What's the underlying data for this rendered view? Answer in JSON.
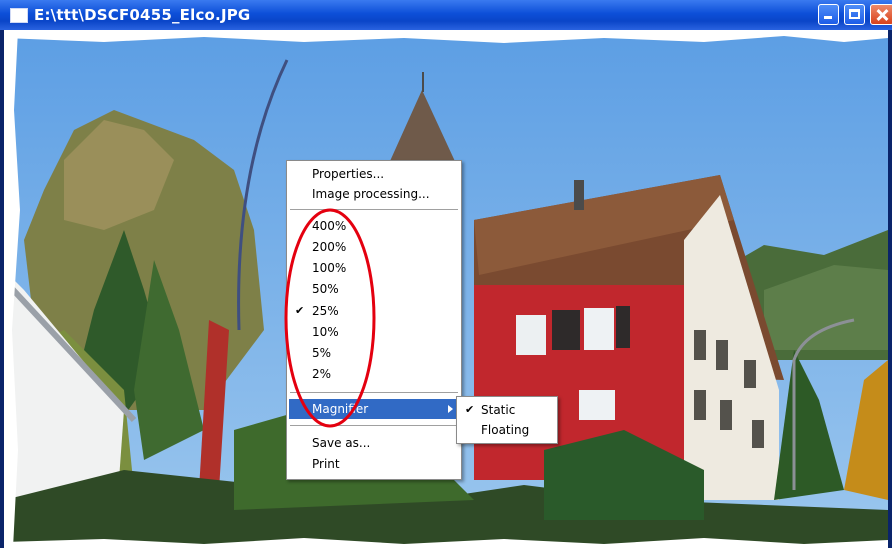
{
  "window": {
    "title": "E:\\ttt\\DSCF0455_Elco.JPG"
  },
  "context_menu": {
    "properties": "Properties...",
    "image_processing": "Image processing...",
    "zoom_levels": [
      "400%",
      "200%",
      "100%",
      "50%",
      "25%",
      "10%",
      "5%",
      "2%"
    ],
    "zoom_checked": "25%",
    "magnifier": "Magnifier",
    "save_as": "Save as...",
    "print": "Print"
  },
  "magnifier_submenu": {
    "static": "Static",
    "floating": "Floating",
    "checked": "Static"
  },
  "colors": {
    "titlebar": "#0a45c8",
    "highlight": "#316ac5",
    "annotation": "#e4000f"
  }
}
